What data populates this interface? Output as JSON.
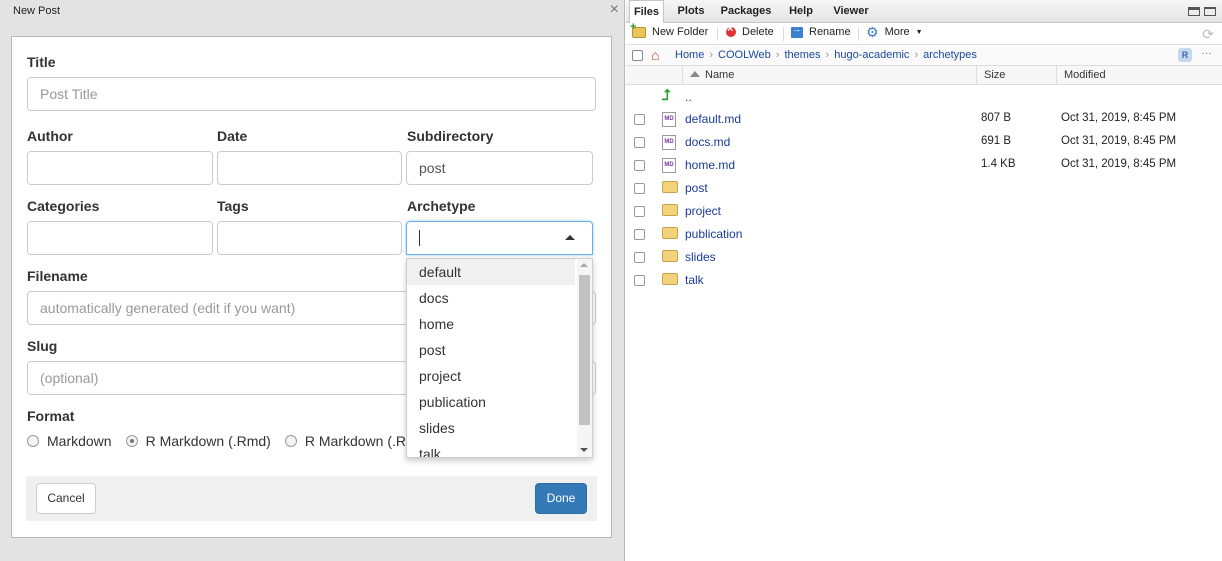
{
  "dialog": {
    "title": "New Post",
    "close_glyph": "×",
    "fields": {
      "title_label": "Title",
      "title_placeholder": "Post Title",
      "author_label": "Author",
      "date_label": "Date",
      "subdirectory_label": "Subdirectory",
      "subdirectory_value": "post",
      "categories_label": "Categories",
      "tags_label": "Tags",
      "archetype_label": "Archetype",
      "filename_label": "Filename",
      "filename_placeholder": "automatically generated (edit if you want)",
      "slug_label": "Slug",
      "slug_placeholder": "(optional)",
      "format_label": "Format"
    },
    "archetype_options": [
      "default",
      "docs",
      "home",
      "post",
      "project",
      "publication",
      "slides",
      "talk"
    ],
    "format_options": [
      {
        "label": "Markdown",
        "selected": false
      },
      {
        "label": "R Markdown (.Rmd)",
        "selected": true
      },
      {
        "label": "R Markdown (.R",
        "selected": false
      }
    ],
    "buttons": {
      "cancel": "Cancel",
      "done": "Done"
    }
  },
  "files_pane": {
    "tabs": [
      "Files",
      "Plots",
      "Packages",
      "Help",
      "Viewer"
    ],
    "active_tab": "Files",
    "toolbar": {
      "new_folder": "New Folder",
      "delete": "Delete",
      "rename": "Rename",
      "more": "More"
    },
    "breadcrumb": [
      "Home",
      "COOLWeb",
      "themes",
      "hugo-academic",
      "archetypes"
    ],
    "columns": {
      "name": "Name",
      "size": "Size",
      "modified": "Modified"
    },
    "parent_row": "..",
    "files": [
      {
        "name": "default.md",
        "type": "md",
        "size": "807 B",
        "modified": "Oct 31, 2019, 8:45 PM"
      },
      {
        "name": "docs.md",
        "type": "md",
        "size": "691 B",
        "modified": "Oct 31, 2019, 8:45 PM"
      },
      {
        "name": "home.md",
        "type": "md",
        "size": "1.4 KB",
        "modified": "Oct 31, 2019, 8:45 PM"
      },
      {
        "name": "post",
        "type": "folder",
        "size": "",
        "modified": ""
      },
      {
        "name": "project",
        "type": "folder",
        "size": "",
        "modified": ""
      },
      {
        "name": "publication",
        "type": "folder",
        "size": "",
        "modified": ""
      },
      {
        "name": "slides",
        "type": "folder",
        "size": "",
        "modified": ""
      },
      {
        "name": "talk",
        "type": "folder",
        "size": "",
        "modified": ""
      }
    ]
  }
}
